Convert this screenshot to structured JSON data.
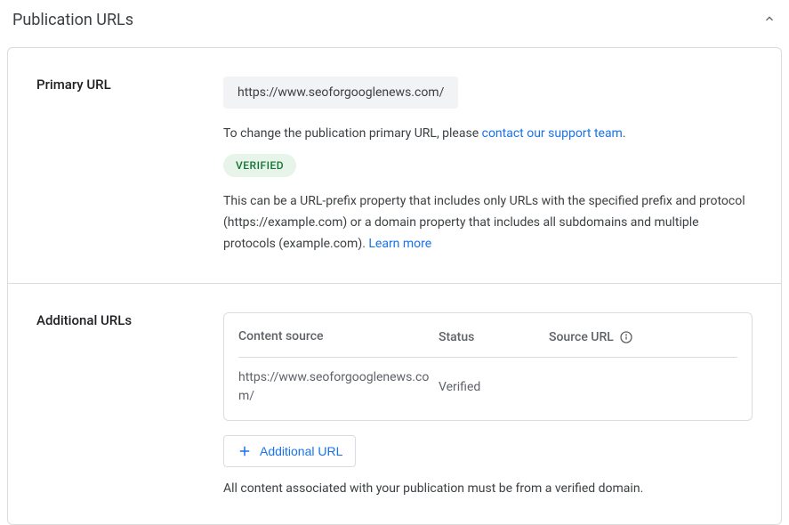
{
  "header": {
    "title": "Publication URLs"
  },
  "primary": {
    "label": "Primary URL",
    "url": "https://www.seoforgooglenews.com/",
    "hint_prefix": "To change the publication primary URL, please ",
    "hint_link": "contact our support team",
    "hint_suffix": ".",
    "badge": "VERIFIED",
    "description_prefix": "This can be a URL-prefix property that includes only URLs with the specified prefix and protocol (https://example.com) or a domain property that includes all subdomains and multiple protocols (example.com). ",
    "learn_more": "Learn more"
  },
  "additional": {
    "label": "Additional URLs",
    "columns": {
      "content_source": "Content source",
      "status": "Status",
      "source_url": "Source URL"
    },
    "rows": [
      {
        "content_source": "https://www.seoforgooglenews.com/",
        "status": "Verified",
        "source_url": ""
      }
    ],
    "add_button": "Additional URL",
    "footer": "All content associated with your publication must be from a verified domain."
  }
}
